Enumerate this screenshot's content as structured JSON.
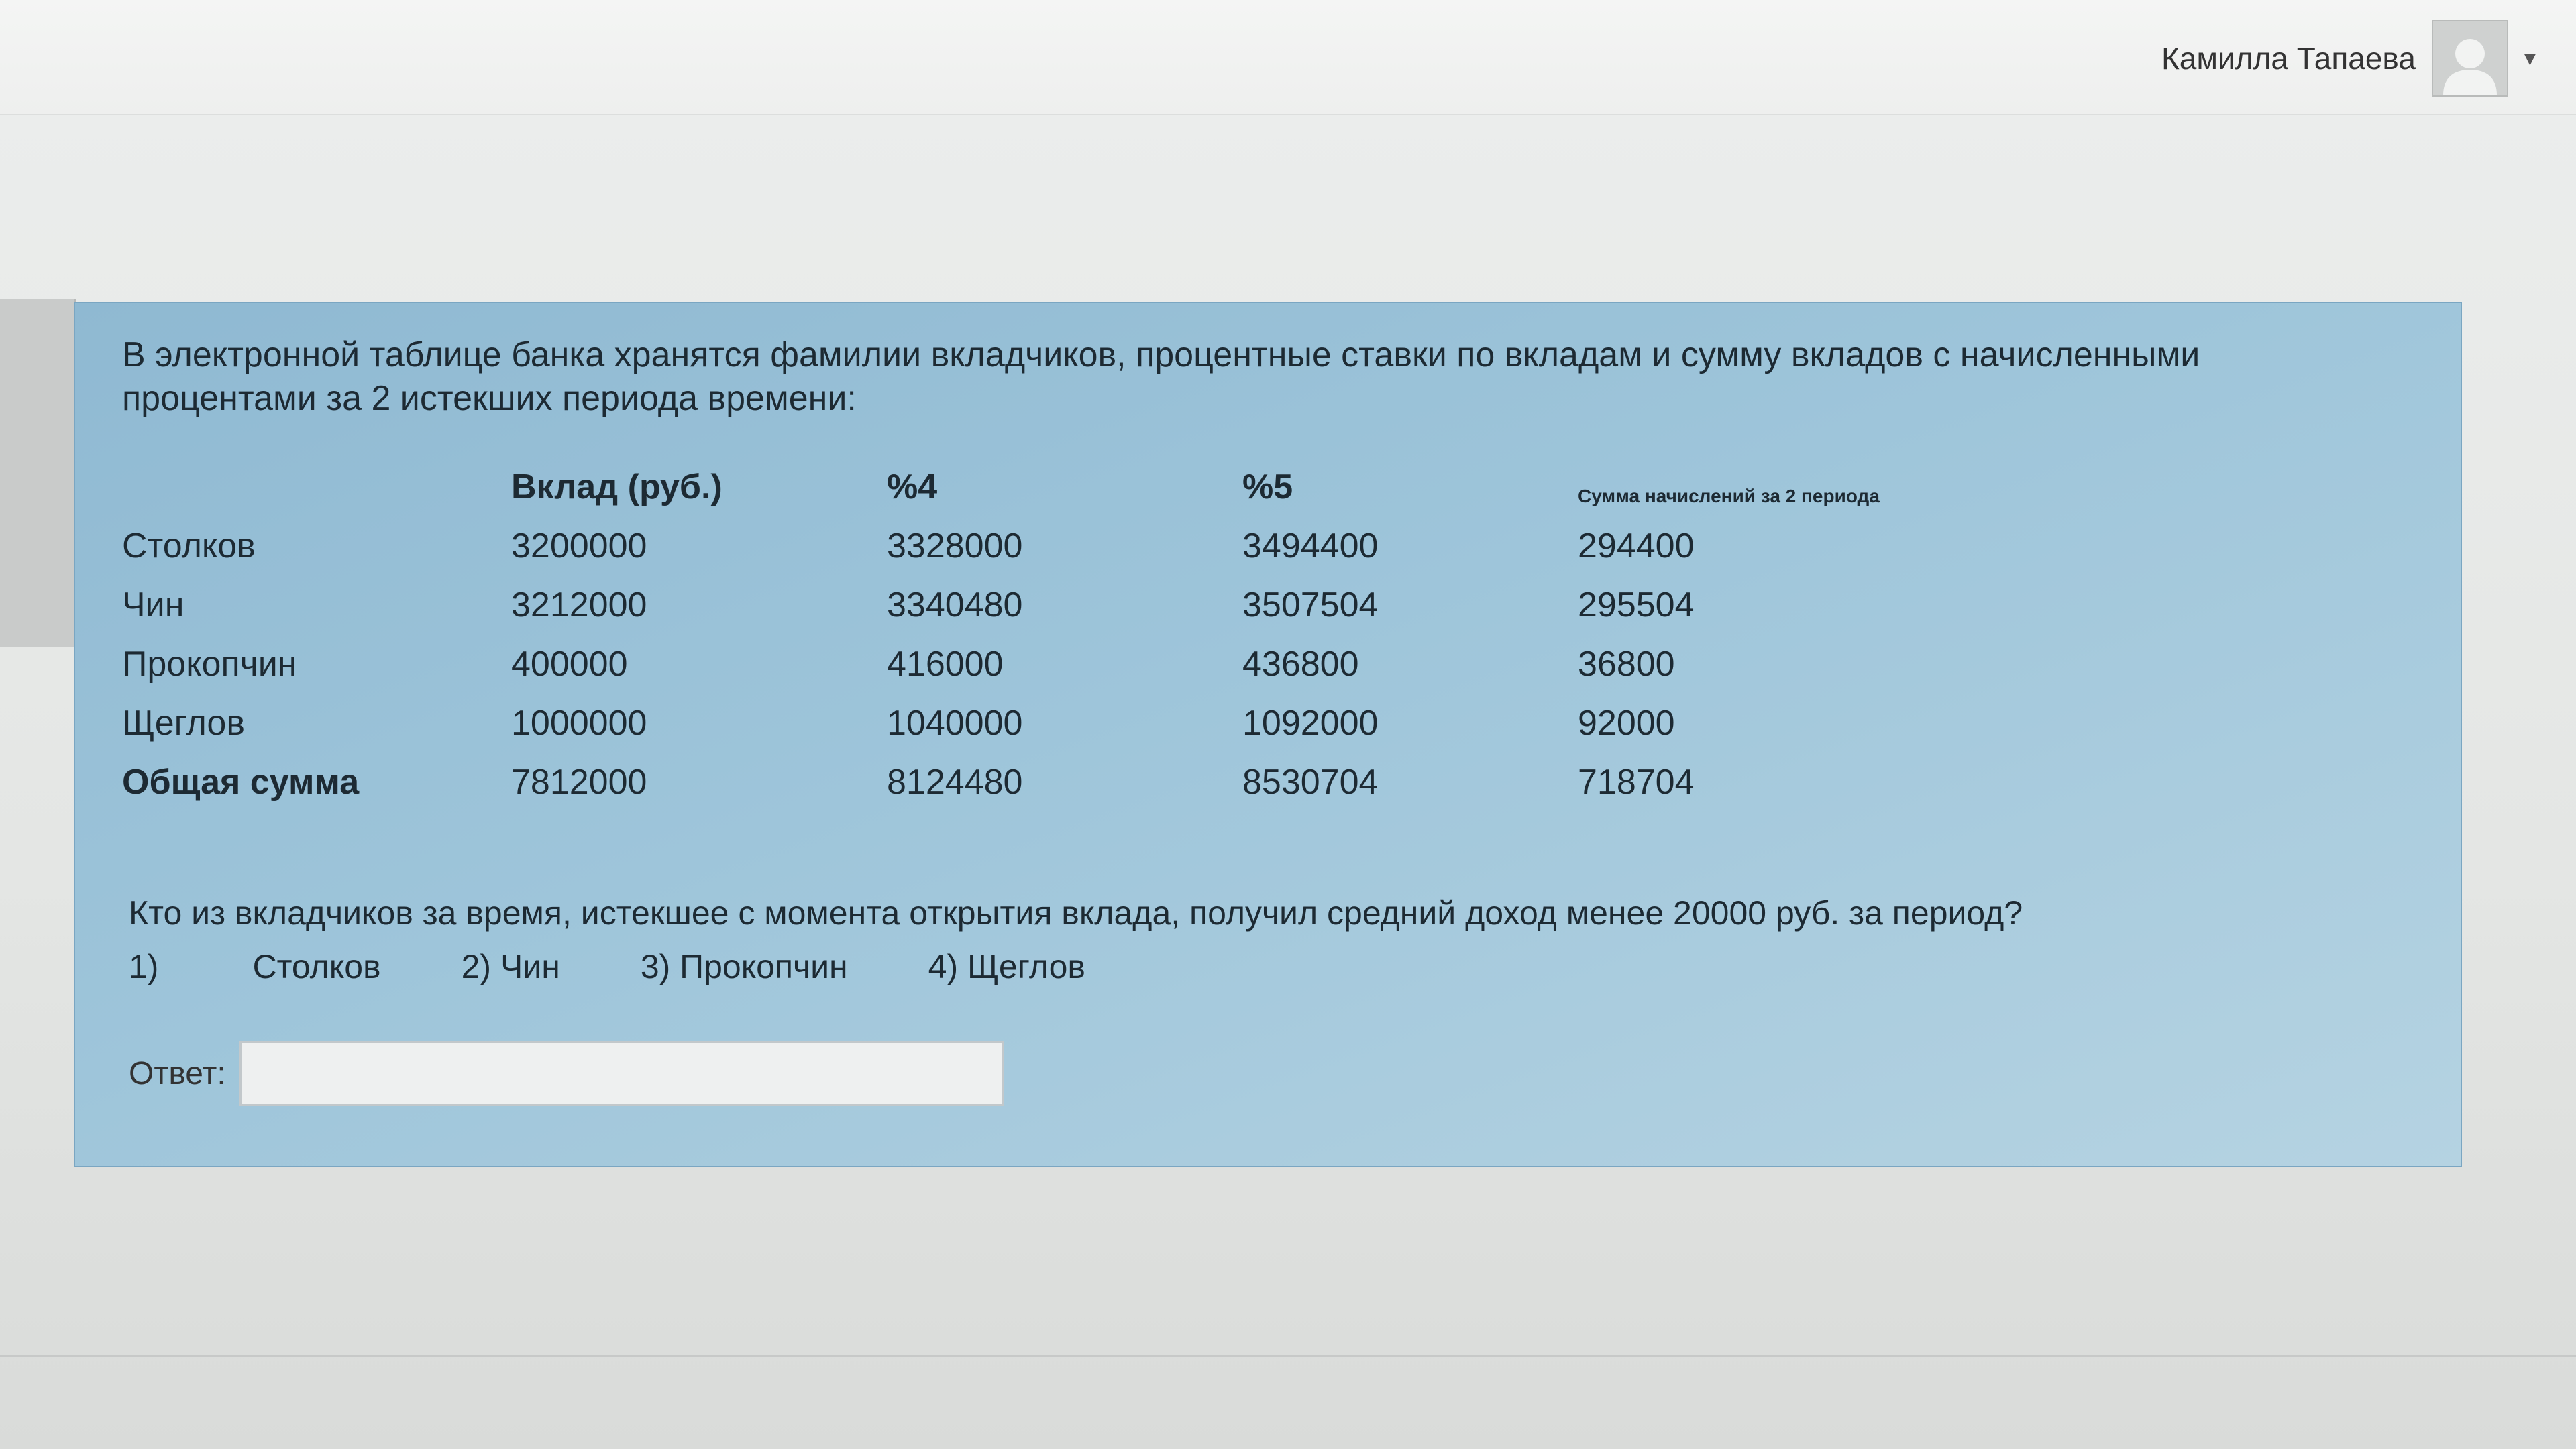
{
  "header": {
    "user_name": "Камилла Тапаева",
    "avatar_icon": "user-avatar-icon",
    "menu_caret": "▾"
  },
  "task": {
    "intro": "В электронной таблице банка хранятся фамилии вкладчиков, процентные ставки по вкладам и сумму вкладов с начисленными процентами за 2 истекших периода времени:",
    "table": {
      "headers": [
        "",
        "Вклад (руб.)",
        "%4",
        "%5",
        "Сумма начислений за 2 периода"
      ],
      "rows": [
        [
          "Столков",
          "3200000",
          "3328000",
          "3494400",
          "294400"
        ],
        [
          "Чин",
          "3212000",
          "3340480",
          "3507504",
          "295504"
        ],
        [
          "Прокопчин",
          "400000",
          "416000",
          "436800",
          "36800"
        ],
        [
          "Щеглов",
          "1000000",
          "1040000",
          "1092000",
          "92000"
        ],
        [
          "Общая сумма",
          "7812000",
          "8124480",
          "8530704",
          "718704"
        ]
      ]
    },
    "question": "Кто из вкладчиков за время, истекшее с момента открытия вклада, получил средний доход менее 20000 руб. за период?",
    "options": {
      "opt1_num": "1)",
      "opt1_text": "Столков",
      "opt2": "2) Чин",
      "opt3": "3) Прокопчин",
      "opt4": "4) Щеглов"
    },
    "answer_label": "Ответ:",
    "answer_value": ""
  }
}
